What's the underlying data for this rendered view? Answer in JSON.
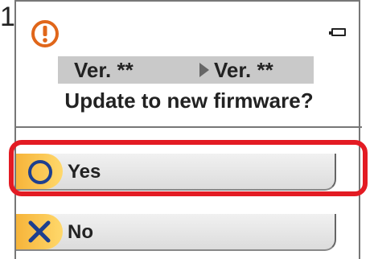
{
  "step": "1.",
  "icons": {
    "warning": "exclamation-circle-icon",
    "battery": "battery-icon",
    "arrow": "triangle-right-icon",
    "yes": "circle-icon",
    "no": "cross-icon"
  },
  "version_bar": {
    "old_version": "Ver. **",
    "new_version": "Ver. **"
  },
  "prompt": "Update to new firmware?",
  "options": {
    "yes_label": "Yes",
    "no_label": "No"
  },
  "colors": {
    "warning": "#e0661a",
    "highlight": "#e31b23",
    "icon_box": "#f6b43a",
    "yes_mark": "#1d3f8f",
    "no_mark": "#1d3f8f"
  }
}
